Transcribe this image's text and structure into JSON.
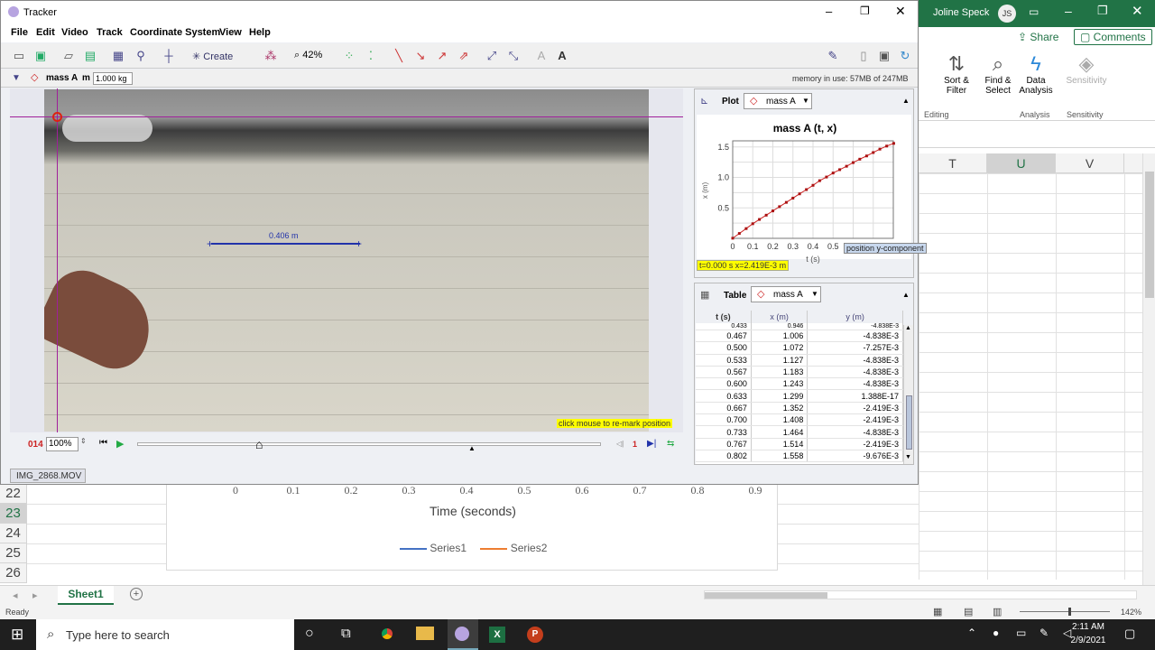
{
  "tracker": {
    "title": "Tracker",
    "menu": [
      "File",
      "Edit",
      "Video",
      "Track",
      "Coordinate System",
      "View",
      "Help"
    ],
    "toolbar": {
      "create_label": "Create",
      "zoom_label": "42%"
    },
    "trackbar": {
      "track_name": "mass A",
      "mass_label": "m",
      "mass_value": "1.000 kg",
      "memory": "memory in use: 57MB of 247MB"
    },
    "video": {
      "calibration_label": "0.406 m",
      "remark_hint": "click mouse to re-mark position"
    },
    "player": {
      "frame": "014",
      "zoom": "100%",
      "step": "1"
    },
    "video_tab": "IMG_2868.MOV",
    "plot": {
      "tab_label": "Plot",
      "track_label": "mass A",
      "title": "mass A (t, x)",
      "ylabel": "x (m)",
      "xlabel": "t (s)",
      "tooltip": "position y-component",
      "readout": "t=0.000 s  x=2.419E-3 m"
    },
    "table": {
      "tab_label": "Table",
      "track_label": "mass A",
      "headers": [
        "t (s)",
        "x (m)",
        "y (m)"
      ],
      "rows": [
        [
          "0.433",
          "0.946",
          "-4.838E-3"
        ],
        [
          "0.467",
          "1.006",
          "-4.838E-3"
        ],
        [
          "0.500",
          "1.072",
          "-7.257E-3"
        ],
        [
          "0.533",
          "1.127",
          "-4.838E-3"
        ],
        [
          "0.567",
          "1.183",
          "-4.838E-3"
        ],
        [
          "0.600",
          "1.243",
          "-4.838E-3"
        ],
        [
          "0.633",
          "1.299",
          "1.388E-17"
        ],
        [
          "0.667",
          "1.352",
          "-2.419E-3"
        ],
        [
          "0.700",
          "1.408",
          "-2.419E-3"
        ],
        [
          "0.733",
          "1.464",
          "-4.838E-3"
        ],
        [
          "0.767",
          "1.514",
          "-2.419E-3"
        ],
        [
          "0.802",
          "1.558",
          "-9.676E-3"
        ]
      ]
    }
  },
  "chart_data": {
    "type": "scatter",
    "title": "mass A (t, x)",
    "xlabel": "t (s)",
    "ylabel": "x (m)",
    "xlim": [
      0,
      0.8
    ],
    "ylim": [
      0,
      1.6
    ],
    "x_ticks": [
      "0",
      "0.1",
      "0.2",
      "0.3",
      "0.4",
      "0.5"
    ],
    "y_ticks": [
      "0.5",
      "1.0",
      "1.5"
    ],
    "x": [
      0,
      0.033,
      0.067,
      0.1,
      0.133,
      0.167,
      0.2,
      0.233,
      0.267,
      0.3,
      0.333,
      0.367,
      0.4,
      0.433,
      0.467,
      0.5,
      0.533,
      0.567,
      0.6,
      0.633,
      0.667,
      0.7,
      0.733,
      0.767,
      0.802
    ],
    "y": [
      0.002,
      0.08,
      0.16,
      0.24,
      0.31,
      0.38,
      0.45,
      0.52,
      0.59,
      0.66,
      0.73,
      0.8,
      0.87,
      0.946,
      1.006,
      1.072,
      1.127,
      1.183,
      1.243,
      1.299,
      1.352,
      1.408,
      1.464,
      1.514,
      1.558
    ],
    "grid": true
  },
  "excel": {
    "user": "Joline Speck",
    "user_initials": "JS",
    "share": "Share",
    "comments": "Comments",
    "ribbon": {
      "sort_filter": "Sort & Filter",
      "find_select": "Find & Select",
      "data_analysis": "Data Analysis",
      "sensitivity": "Sensitivity",
      "group_editing": "Editing",
      "group_analysis": "Analysis",
      "group_sensitivity": "Sensitivity"
    },
    "columns": [
      "T",
      "U",
      "V"
    ],
    "rows": [
      "22",
      "23",
      "24",
      "25",
      "26"
    ],
    "chart": {
      "x_ticks": [
        "0",
        "0.1",
        "0.2",
        "0.3",
        "0.4",
        "0.5",
        "0.6",
        "0.7",
        "0.8",
        "0.9"
      ],
      "xlabel": "Time (seconds)",
      "series": [
        "Series1",
        "Series2"
      ],
      "series_colors": [
        "#4472c4",
        "#ed7d31"
      ]
    },
    "sheet_tab": "Sheet1",
    "status": "Ready",
    "zoom": "142%"
  },
  "taskbar": {
    "search_placeholder": "Type here to search",
    "time": "2:11 AM",
    "date": "2/9/2021"
  }
}
